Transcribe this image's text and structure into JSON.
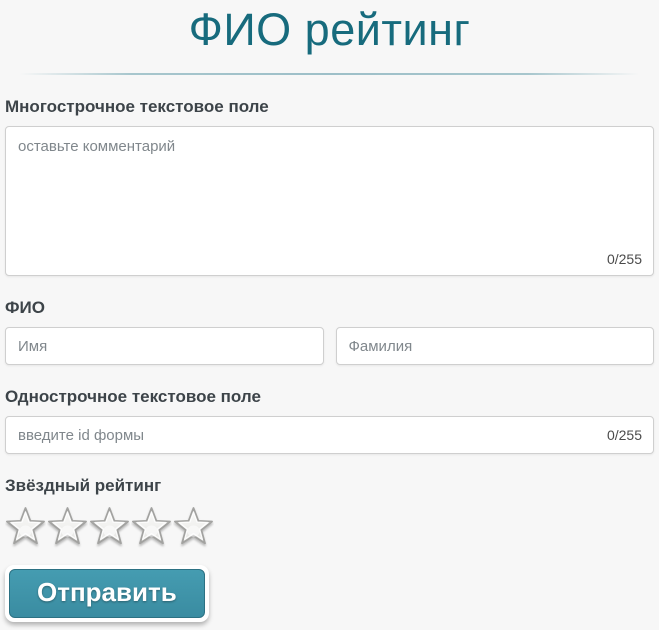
{
  "page": {
    "title": "ФИО рейтинг",
    "background_color": "#f7f7f7",
    "accent_color": "#176b7d",
    "button_color": "#3e93a8"
  },
  "comment_section": {
    "label": "Многострочное текстовое поле",
    "placeholder": "оставьте комментарий",
    "counter": "0/255"
  },
  "name_section": {
    "label": "ФИО",
    "first_name_placeholder": "Имя",
    "last_name_placeholder": "Фамилия"
  },
  "single_line_section": {
    "label": "Однострочное текстовое поле",
    "placeholder": "введите id формы",
    "counter": "0/255"
  },
  "rating_section": {
    "label": "Звёздный рейтинг",
    "stars_total": 5,
    "stars_selected": 0
  },
  "submit": {
    "label": "Отправить"
  }
}
